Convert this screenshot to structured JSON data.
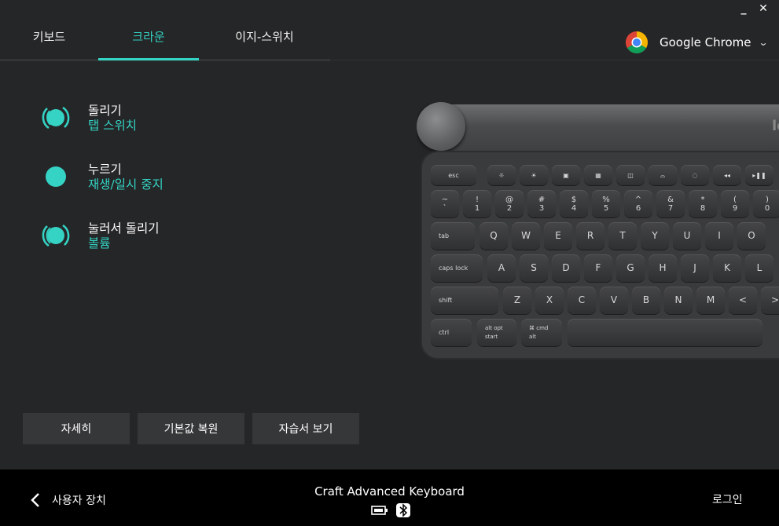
{
  "window": {
    "minimize_glyph": "_",
    "close_glyph": "✕"
  },
  "tabs": [
    {
      "label": "키보드",
      "active": false
    },
    {
      "label": "크라운",
      "active": true
    },
    {
      "label": "이지-스위치",
      "active": false
    }
  ],
  "app_selector": {
    "app_name": "Google Chrome",
    "icon": "chrome-icon"
  },
  "crown_actions": [
    {
      "title": "돌리기",
      "subtitle": "탭 스위치",
      "icon": "crown-turn-icon"
    },
    {
      "title": "누르기",
      "subtitle": "재생/일시 중지",
      "icon": "crown-press-icon"
    },
    {
      "title": "눌러서 돌리기",
      "subtitle": "볼륨",
      "icon": "crown-press-turn-icon"
    }
  ],
  "buttons": {
    "more": "자세히",
    "restore_defaults": "기본값 복원",
    "tutorial": "자습서 보기"
  },
  "footer": {
    "back_label": "사용자 장치",
    "device_name": "Craft Advanced Keyboard",
    "login": "로그인"
  },
  "keyboard": {
    "logo": "lo",
    "fn_row": [
      "esc",
      "☼",
      "☀",
      "▣",
      "▦",
      "◫",
      "⌓",
      "◌",
      "◂◂",
      "▸❚❚"
    ],
    "num_row": [
      [
        "~",
        "`"
      ],
      [
        "!",
        "1"
      ],
      [
        "@",
        "2"
      ],
      [
        "#",
        "3"
      ],
      [
        "$",
        "4"
      ],
      [
        "%",
        "5"
      ],
      [
        "^",
        "6"
      ],
      [
        "&",
        "7"
      ],
      [
        "*",
        "8"
      ],
      [
        "(",
        "9"
      ],
      [
        ")",
        "0"
      ]
    ],
    "q_row": [
      "tab",
      "Q",
      "W",
      "E",
      "R",
      "T",
      "Y",
      "U",
      "I",
      "O"
    ],
    "a_row": [
      "caps lock",
      "A",
      "S",
      "D",
      "F",
      "G",
      "H",
      "J",
      "K",
      "L"
    ],
    "z_row": [
      "shift",
      "Z",
      "X",
      "C",
      "V",
      "B",
      "N",
      "M",
      "<",
      ">"
    ],
    "bottom_row": [
      "ctrl",
      "alt opt",
      "start",
      "⌘ cmd",
      "alt"
    ]
  },
  "colors": {
    "accent": "#34d3c4",
    "background": "#252627",
    "footer": "#000000",
    "button": "#363738"
  }
}
